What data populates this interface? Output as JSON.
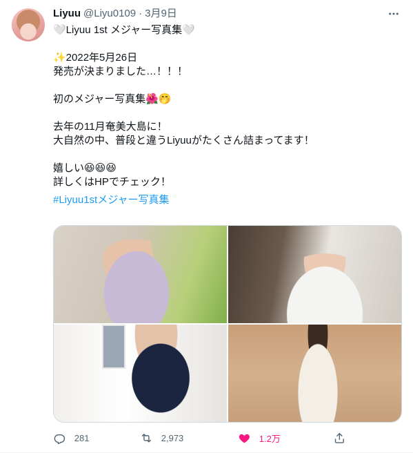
{
  "tweet": {
    "name": "Liyuu",
    "handle": "@Liyu0109",
    "separator": "·",
    "date": "3月9日",
    "more_icon": "more-horizontal-icon",
    "text": "🤍Liyuu 1st メジャー写真集🤍\n\n✨2022年5月26日\n発売が決まりました…！！！\n\n初のメジャー写真集🌺🤭\n\n去年の11月奄美大島に！\n大自然の中、普段と違うLiyuuがたくさん詰まってます！\n\n嬉しい😆😆😆\n詳しくはHPでチェック！",
    "hashtag": "#Liyuu1stメジャー写真集",
    "media_count": 4
  },
  "actions": {
    "reply_count": "281",
    "retweet_count": "2,973",
    "like_count": "1.2万",
    "share_icon": "share-icon"
  },
  "colors": {
    "link": "#1d9bf0",
    "muted": "#536471",
    "like_active": "#f91880",
    "text": "#0f1419"
  }
}
